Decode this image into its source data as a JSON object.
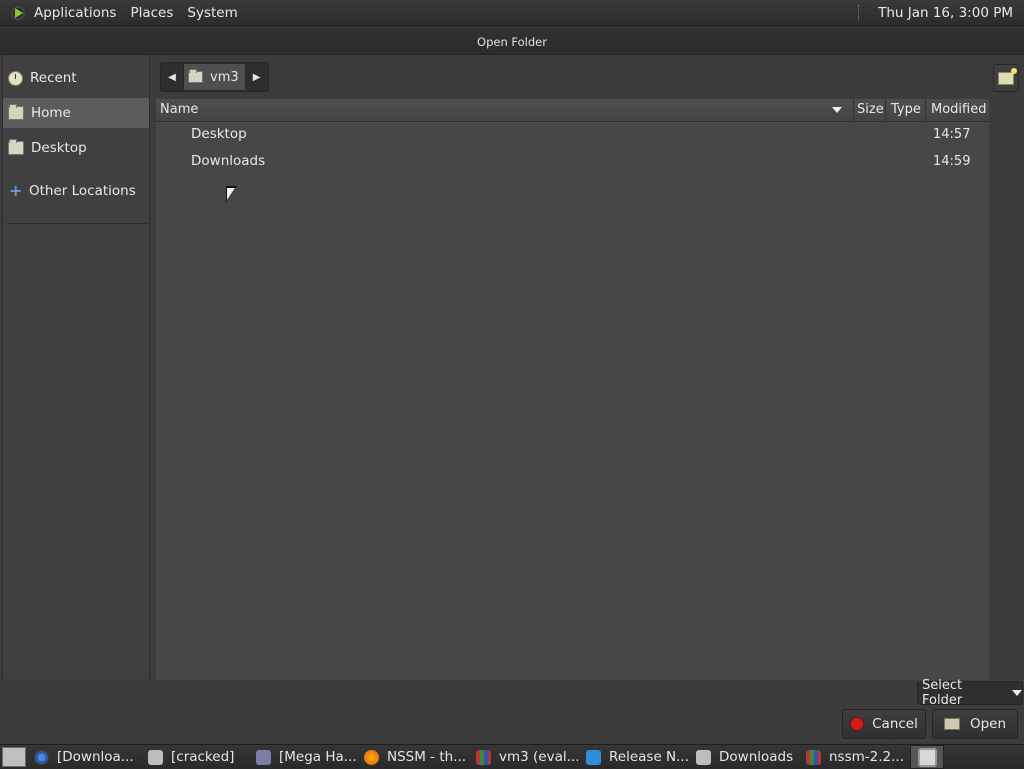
{
  "top_panel": {
    "menus": [
      "Applications",
      "Places",
      "System"
    ],
    "clock": "Thu Jan 16,  3:00 PM"
  },
  "dialog": {
    "title": "Open Folder"
  },
  "sidebar": {
    "items": [
      {
        "label": "Recent",
        "icon": "clock-icon"
      },
      {
        "label": "Home",
        "icon": "home-folder-icon",
        "selected": true
      },
      {
        "label": "Desktop",
        "icon": "desktop-folder-icon"
      },
      {
        "label": "Other Locations",
        "icon": "plus-icon"
      }
    ]
  },
  "pathbar": {
    "current": "vm3"
  },
  "file_list": {
    "columns": [
      "Name",
      "Size",
      "Type",
      "Modified"
    ],
    "rows": [
      {
        "name": "Desktop",
        "size": "",
        "type": "",
        "modified": "14:57"
      },
      {
        "name": "Downloads",
        "size": "",
        "type": "",
        "modified": "14:59"
      }
    ]
  },
  "footer": {
    "filter": "Select Folder",
    "cancel_label": "Cancel",
    "open_label": "Open"
  },
  "taskbar": {
    "tasks": [
      {
        "label": "[Downloa...",
        "icon": "chrome-icon"
      },
      {
        "label": "[cracked]",
        "icon": "folder-icon"
      },
      {
        "label": "[Mega Ha...",
        "icon": "pidgin-icon"
      },
      {
        "label": "NSSM - th...",
        "icon": "firefox-icon"
      },
      {
        "label": "vm3 (eval...",
        "icon": "archive-icon"
      },
      {
        "label": "Release N...",
        "icon": "vscode-icon"
      },
      {
        "label": "Downloads",
        "icon": "folder-icon"
      },
      {
        "label": "nssm-2.2...",
        "icon": "archive-icon"
      }
    ]
  }
}
